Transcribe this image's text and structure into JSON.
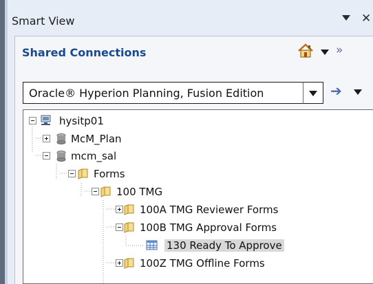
{
  "pane": {
    "title": "Smart View",
    "menu_icon": "dropdown-arrow",
    "close_label": "✕"
  },
  "section": {
    "title": "Shared Connections",
    "home_icon": "home-icon",
    "more_label": "»"
  },
  "connection": {
    "selected": "Oracle® Hyperion Planning, Fusion Edition",
    "go_label": "➔"
  },
  "tree": [
    {
      "label": "hysitp01",
      "icon": "server-icon",
      "toggle": "minus"
    },
    {
      "label": "McM_Plan",
      "icon": "database-icon",
      "toggle": "plus"
    },
    {
      "label": "mcm_sal",
      "icon": "database-icon",
      "toggle": "minus"
    },
    {
      "label": "Forms",
      "icon": "folder-icon",
      "toggle": "minus"
    },
    {
      "label": "100 TMG",
      "icon": "folder-icon",
      "toggle": "minus"
    },
    {
      "label": "100A TMG Reviewer Forms",
      "icon": "folder-icon",
      "toggle": "plus"
    },
    {
      "label": "100B TMG Approval Forms",
      "icon": "folder-icon",
      "toggle": "minus"
    },
    {
      "label": "130 Ready To Approve",
      "icon": "form-icon",
      "toggle": "none",
      "selected": true
    },
    {
      "label": "100Z TMG Offline Forms",
      "icon": "folder-icon",
      "toggle": "plus"
    }
  ]
}
